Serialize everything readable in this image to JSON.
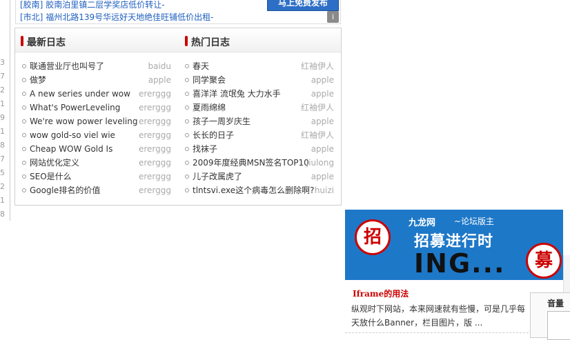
{
  "left_edge_numbers": [
    "3",
    "7",
    "2",
    "1",
    "9",
    "1",
    "8",
    "7",
    "5",
    "2",
    "1",
    "8"
  ],
  "ad": {
    "line1_tag": "[胶南]",
    "line1_text": "胶南泊里镇二层学奖店低价转让-",
    "line2_tag": "[市北]",
    "line2_text": "福州北路139号华远好天地绝佳旺铺低价出租-",
    "button": "马上免费发布",
    "info": "i"
  },
  "blog": {
    "latest_title": "最新日志",
    "hot_title": "热门日志",
    "latest": [
      {
        "title": "联通营业厅也叫号了",
        "author": "baidu"
      },
      {
        "title": "做梦",
        "author": "apple"
      },
      {
        "title": "A new series under wow",
        "author": "ererggg"
      },
      {
        "title": "What's PowerLeveling",
        "author": "ererggg"
      },
      {
        "title": "We're wow power leveling",
        "author": "ererggg"
      },
      {
        "title": "wow gold-so viel wie",
        "author": "ererggg"
      },
      {
        "title": "Cheap WOW Gold Is",
        "author": "ererggg"
      },
      {
        "title": "网站优化定义",
        "author": "ererggg"
      },
      {
        "title": "SEO是什么",
        "author": "ererggg"
      },
      {
        "title": "Google排名的价值",
        "author": "ererggg"
      }
    ],
    "hot": [
      {
        "title": "春天",
        "author": "红袖伊人"
      },
      {
        "title": "同学聚会",
        "author": "apple"
      },
      {
        "title": "喜洋洋 流氓兔 大力水手",
        "author": "apple"
      },
      {
        "title": "夏雨绵绵",
        "author": "红袖伊人"
      },
      {
        "title": "孩子一周岁庆生",
        "author": "apple"
      },
      {
        "title": "长长的日子",
        "author": "红袖伊人"
      },
      {
        "title": "找袜子",
        "author": "apple"
      },
      {
        "title": "2009年度经典MSN签名TOP10",
        "author": "jiulong"
      },
      {
        "title": "儿子改属虎了",
        "author": "apple"
      },
      {
        "title": "tlntsvi.exe这个病毒怎么删除啊?",
        "author": "huizi"
      }
    ]
  },
  "banner": {
    "circle_left": "招",
    "brand": "九龙网",
    "sub": "~论坛版主",
    "headline": "招募进行时",
    "ing": "ING...",
    "circle_right": "募",
    "color": "#1e78c8"
  },
  "article": {
    "title": "Iframe的用法",
    "text": "纵观时下网站，本来网速就有些慢，可是几乎每天放什么Banner，栏目图片，版 ..."
  },
  "popup": {
    "label": "音量"
  }
}
